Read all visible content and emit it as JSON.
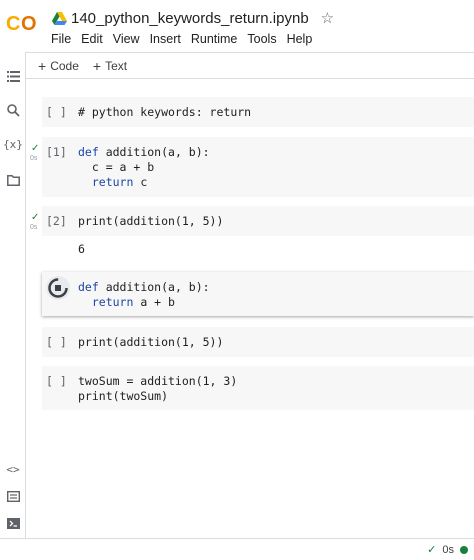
{
  "app": {
    "logo_text": "CO",
    "notebook_title": "140_python_keywords_return.ipynb",
    "star": "☆"
  },
  "menu": [
    "File",
    "Edit",
    "View",
    "Insert",
    "Runtime",
    "Tools",
    "Help"
  ],
  "toolbar": {
    "code_label": "Code",
    "text_label": "Text",
    "plus": "+"
  },
  "rail_icons": [
    "menu-icon",
    "search-icon",
    "variables-icon",
    "files-icon",
    "code-snippets-icon",
    "command-palette-icon",
    "terminal-icon"
  ],
  "rail": {
    "variables_glyph": "{x}",
    "code_glyph": "<>"
  },
  "cells": [
    {
      "prompt": "[ ]",
      "comment": "# python keywords: return"
    },
    {
      "prompt": "[1]",
      "line1_kw": "def",
      "line1_rest": " addition(a, b):",
      "line2": "  c = a + b",
      "line3_kw": "  return",
      "line3_rest": " c",
      "check": "✓",
      "time": "0s"
    },
    {
      "prompt": "[2]",
      "code": "print(addition(1, 5))",
      "output": "6",
      "check": "✓",
      "time": "0s"
    },
    {
      "line1_kw": "def",
      "line1_rest": " addition(a, b):",
      "line2_kw": "  return",
      "line2_rest": " a + b"
    },
    {
      "prompt": "[ ]",
      "code": "print(addition(1, 5))"
    },
    {
      "prompt": "[ ]",
      "line1": "twoSum = addition(1, 3)",
      "line2": "print(twoSum)"
    }
  ],
  "status": {
    "check": "✓",
    "time": "0s"
  },
  "colors": {
    "keyword": "#1a46a6",
    "success": "#188038",
    "logo_orange": "#f9ab00",
    "logo_dark_orange": "#e37400"
  }
}
